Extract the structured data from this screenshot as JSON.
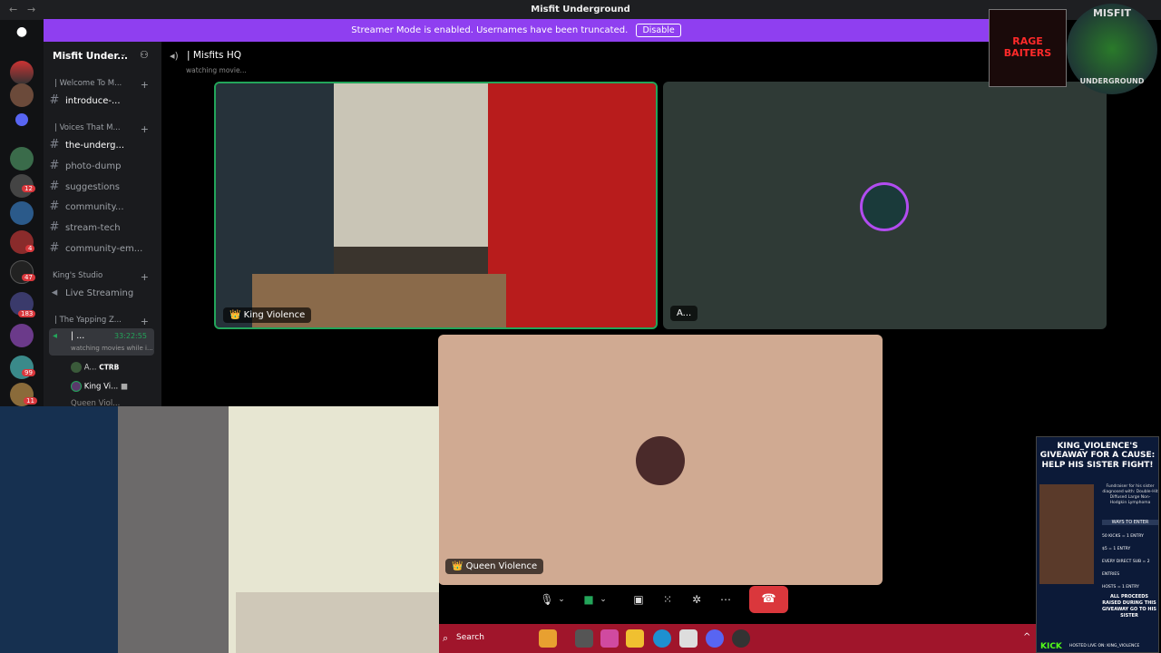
{
  "window": {
    "title": "Misfit Underground",
    "nav_back": "←",
    "nav_fwd": "→"
  },
  "banner": {
    "text": "Streamer Mode is enabled. Usernames have been truncated.",
    "button": "Disable"
  },
  "server": {
    "name": "Misfit Under...",
    "badges": [
      "12",
      "4",
      "47",
      "183",
      "99",
      "11"
    ]
  },
  "categories": [
    {
      "label": "| Welcome To M..."
    },
    {
      "label": "| Voices That M..."
    },
    {
      "label": "King's Studio"
    },
    {
      "label": "| The Yapping Z..."
    }
  ],
  "channels": [
    {
      "label": "introduce-...",
      "active": true
    },
    {
      "label": "the-underg...",
      "active": true
    },
    {
      "label": "photo-dump"
    },
    {
      "label": "suggestions"
    },
    {
      "label": "community..."
    },
    {
      "label": "stream-tech"
    },
    {
      "label": "community-em..."
    }
  ],
  "voice": {
    "live_streaming": "Live Streaming",
    "current": {
      "label": "| ...",
      "timer": "33:22:55",
      "status": "watching movies while i..."
    },
    "users": [
      {
        "name": "A...",
        "tag": "CTRB"
      },
      {
        "name": "King Vi..."
      },
      {
        "name": "Queen Viol..."
      }
    ]
  },
  "header": {
    "channel": "| Misfits HQ",
    "status": "watching movie..."
  },
  "tiles": {
    "king": {
      "name": "King Violence"
    },
    "a": {
      "name": "A..."
    },
    "queen": {
      "name": "Queen Violence"
    }
  },
  "overlay": {
    "logo1": "RAGE BAITERS",
    "logo2_top": "MISFIT",
    "logo2_bottom": "UNDERGROUND",
    "ad": {
      "title": "KING_VIOLENCE'S",
      "subtitle": "GIVEAWAY FOR A CAUSE: HELP HIS SISTER FIGHT!",
      "body": "Fundraiser for his sister diagnosed with: Double-Hit Diffused Large Non-Hodgkin Lymphoma",
      "ways": "WAYS TO ENTER",
      "entries": [
        "50 KICKS = 1 ENTRY",
        "$5 = 1 ENTRY",
        "EVERY DIRECT SUB = 2 ENTRIES",
        "HOSTS = 1 ENTRY"
      ],
      "proceeds": "ALL PROCEEDS RAISED DURING THIS GIVEAWAY GO TO HIS SISTER",
      "kick": "KICK",
      "hosted": "HOSTED LIVE ON: KING_VIOLENCE"
    }
  },
  "taskbar": {
    "search": "Search"
  },
  "colors": {
    "accent": "#8f3ff0",
    "hangup": "#da373c",
    "taskbar": "#a0152b",
    "speaking": "#23a55a"
  }
}
